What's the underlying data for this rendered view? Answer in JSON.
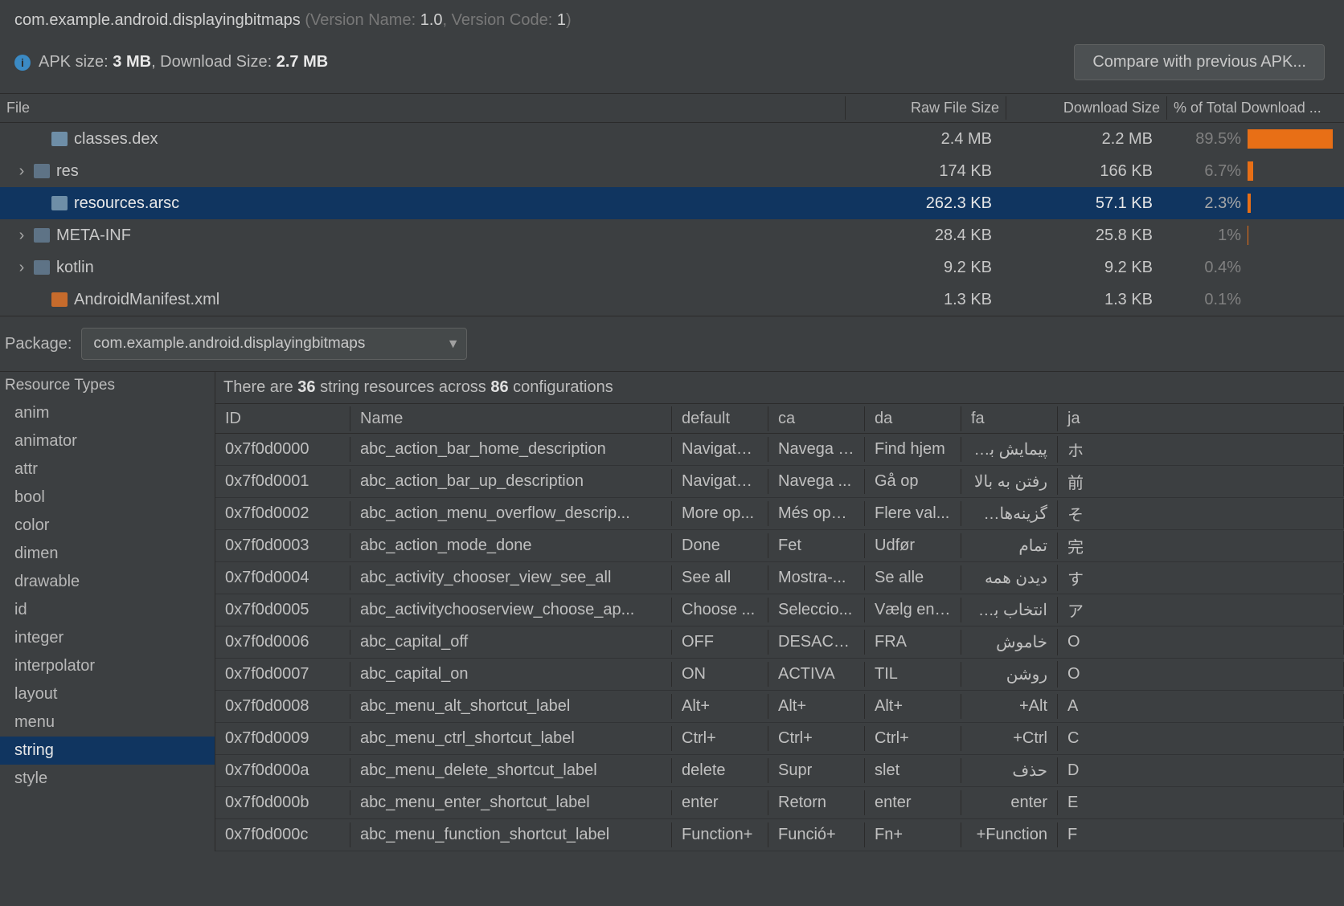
{
  "header": {
    "package_name": "com.example.android.displayingbitmaps",
    "version_name_label": " (Version Name: ",
    "version_name": "1.0",
    "version_code_label": ", Version Code: ",
    "version_code": "1",
    "close_paren": ")",
    "apk_size_label": "APK size: ",
    "apk_size": "3 MB",
    "download_size_label": ", Download Size: ",
    "download_size": "2.7 MB",
    "compare_button": "Compare with previous APK..."
  },
  "file_table": {
    "headers": {
      "file": "File",
      "raw": "Raw File Size",
      "dl": "Download Size",
      "pct": "% of Total Download ..."
    },
    "rows": [
      {
        "expand": "",
        "icon": "dex",
        "name": "classes.dex",
        "raw": "2.4 MB",
        "dl": "2.2 MB",
        "pct": "89.5%",
        "bar": 88,
        "indent": 42,
        "selected": false
      },
      {
        "expand": "›",
        "icon": "folder",
        "name": "res",
        "raw": "174 KB",
        "dl": "166 KB",
        "pct": "6.7%",
        "bar": 6,
        "indent": 20,
        "selected": false
      },
      {
        "expand": "",
        "icon": "arsc",
        "name": "resources.arsc",
        "raw": "262.3 KB",
        "dl": "57.1 KB",
        "pct": "2.3%",
        "bar": 3,
        "indent": 42,
        "selected": true
      },
      {
        "expand": "›",
        "icon": "folder",
        "name": "META-INF",
        "raw": "28.4 KB",
        "dl": "25.8 KB",
        "pct": "1%",
        "bar": 1,
        "indent": 20,
        "selected": false
      },
      {
        "expand": "›",
        "icon": "folder",
        "name": "kotlin",
        "raw": "9.2 KB",
        "dl": "9.2 KB",
        "pct": "0.4%",
        "bar": 0,
        "indent": 20,
        "selected": false
      },
      {
        "expand": "",
        "icon": "xml",
        "name": "AndroidManifest.xml",
        "raw": "1.3 KB",
        "dl": "1.3 KB",
        "pct": "0.1%",
        "bar": 0,
        "indent": 42,
        "selected": false
      }
    ]
  },
  "package_selector": {
    "label": "Package:",
    "value": "com.example.android.displayingbitmaps"
  },
  "resource_types": {
    "header": "Resource Types",
    "items": [
      "anim",
      "animator",
      "attr",
      "bool",
      "color",
      "dimen",
      "drawable",
      "id",
      "integer",
      "interpolator",
      "layout",
      "menu",
      "string",
      "style"
    ],
    "selected": "string"
  },
  "resources_summary": {
    "prefix": "There are ",
    "count": "36",
    "mid": " string resources across ",
    "configs": "86",
    "suffix": " configurations"
  },
  "string_table": {
    "headers": [
      "ID",
      "Name",
      "default",
      "ca",
      "da",
      "fa",
      "ja"
    ],
    "rows": [
      {
        "id": "0x7f0d0000",
        "name": "abc_action_bar_home_description",
        "default": "Navigate...",
        "ca": "Navega f...",
        "da": "Find hjem",
        "fa": "پیمایش به ...",
        "ja": "ホ"
      },
      {
        "id": "0x7f0d0001",
        "name": "abc_action_bar_up_description",
        "default": "Navigate...",
        "ca": "Navega ...",
        "da": "Gå op",
        "fa": "رفتن به بالا",
        "ja": "前"
      },
      {
        "id": "0x7f0d0002",
        "name": "abc_action_menu_overflow_descrip...",
        "default": "More op...",
        "ca": "Més opci...",
        "da": "Flere val...",
        "fa": "گزینه‌های بی...",
        "ja": "そ"
      },
      {
        "id": "0x7f0d0003",
        "name": "abc_action_mode_done",
        "default": "Done",
        "ca": "Fet",
        "da": "Udfør",
        "fa": "تمام",
        "ja": "完"
      },
      {
        "id": "0x7f0d0004",
        "name": "abc_activity_chooser_view_see_all",
        "default": "See all",
        "ca": "Mostra-...",
        "da": "Se alle",
        "fa": "دیدن همه",
        "ja": "す"
      },
      {
        "id": "0x7f0d0005",
        "name": "abc_activitychooserview_choose_ap...",
        "default": "Choose ...",
        "ca": "Seleccio...",
        "da": "Vælg en ...",
        "fa": "انتخاب برنامه",
        "ja": "ア"
      },
      {
        "id": "0x7f0d0006",
        "name": "abc_capital_off",
        "default": "OFF",
        "ca": "DESACTI...",
        "da": "FRA",
        "fa": "خاموش",
        "ja": "O"
      },
      {
        "id": "0x7f0d0007",
        "name": "abc_capital_on",
        "default": "ON",
        "ca": "ACTIVA",
        "da": "TIL",
        "fa": "روشن",
        "ja": "O"
      },
      {
        "id": "0x7f0d0008",
        "name": "abc_menu_alt_shortcut_label",
        "default": "Alt+",
        "ca": "Alt+",
        "da": "Alt+",
        "fa": "Alt+",
        "ja": "A"
      },
      {
        "id": "0x7f0d0009",
        "name": "abc_menu_ctrl_shortcut_label",
        "default": "Ctrl+",
        "ca": "Ctrl+",
        "da": "Ctrl+",
        "fa": "Ctrl+",
        "ja": "C"
      },
      {
        "id": "0x7f0d000a",
        "name": "abc_menu_delete_shortcut_label",
        "default": "delete",
        "ca": "Supr",
        "da": "slet",
        "fa": "حذف",
        "ja": "D"
      },
      {
        "id": "0x7f0d000b",
        "name": "abc_menu_enter_shortcut_label",
        "default": "enter",
        "ca": "Retorn",
        "da": "enter",
        "fa": "enter",
        "ja": "E"
      },
      {
        "id": "0x7f0d000c",
        "name": "abc_menu_function_shortcut_label",
        "default": "Function+",
        "ca": "Funció+",
        "da": "Fn+",
        "fa": "Function+",
        "ja": "F"
      }
    ]
  }
}
